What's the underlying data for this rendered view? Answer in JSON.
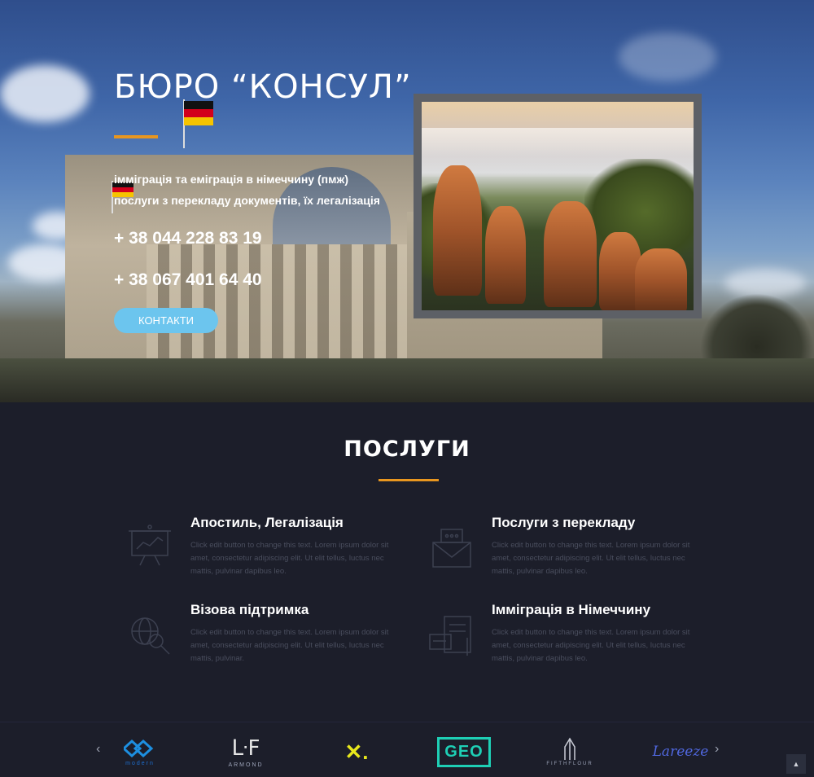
{
  "hero": {
    "title": "БЮРО “КОНСУЛ”",
    "line1": "імміграція та еміграція в німеччину (пмж)",
    "line2": "послуги з перекладу документів, їх легалізація",
    "phone1": "+ 38 044 228 83 19",
    "phone2": "+ 38 067 401 64 40",
    "contact_button": "КОНТАКТИ",
    "accent_color": "#e8961f",
    "button_color": "#6cc5ee"
  },
  "services": {
    "title": "ПОСЛУГИ",
    "items": [
      {
        "title": "Апостиль, Легалізація",
        "text": "Click edit button to change this text. Lorem ipsum dolor sit amet, consectetur adipiscing elit. Ut elit tellus, luctus nec mattis, pulvinar dapibus leo.",
        "icon": "presentation-board-icon"
      },
      {
        "title": "Послуги з перекладу",
        "text": "Click edit button to change this text. Lorem ipsum dolor sit amet, consectetur adipiscing elit. Ut elit tellus, luctus nec mattis, pulvinar dapibus leo.",
        "icon": "envelope-message-icon"
      },
      {
        "title": "Візова підтримка",
        "text": "Click edit button to change this text. Lorem ipsum dolor sit amet, consectetur adipiscing elit. Ut elit tellus, luctus nec mattis, pulvinar.",
        "icon": "globe-search-icon"
      },
      {
        "title": "Імміграція в Німеччину",
        "text": "Click edit button to change this text. Lorem ipsum dolor sit amet, consectetur adipiscing elit. Ut elit tellus, luctus nec mattis, pulvinar dapibus leo.",
        "icon": "document-card-icon"
      }
    ]
  },
  "clients": {
    "prev": "‹",
    "next": "›",
    "logos": [
      {
        "name": "modern",
        "caption": "modern",
        "color": "#1d8fe0"
      },
      {
        "name": "armond",
        "mark": "ᒷF",
        "caption": "ARMOND",
        "color": "#ffffff"
      },
      {
        "name": "x-logo",
        "mark": "✕.",
        "caption": "",
        "color": "#e8e81c"
      },
      {
        "name": "geo",
        "mark": "GEO",
        "caption": "",
        "color": "#1ecfb5"
      },
      {
        "name": "fifthflour",
        "caption": "FIFTHFLOUR",
        "color": "#c9ccd6"
      },
      {
        "name": "lareeze",
        "mark": "Lareeze",
        "caption": "",
        "color": "#3b57d6"
      }
    ],
    "to_top": "▲"
  }
}
